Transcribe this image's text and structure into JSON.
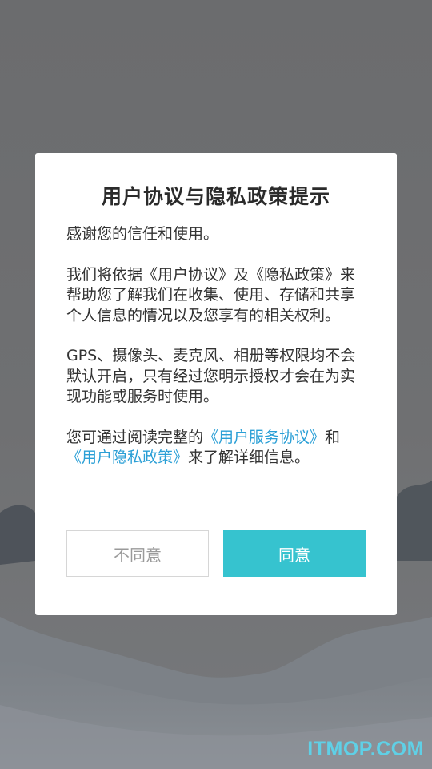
{
  "dialog": {
    "title": "用户协议与隐私政策提示",
    "para1": "感谢您的信任和使用。",
    "para2": "我们将依据《用户协议》及《隐私政策》来帮助您了解我们在收集、使用、存储和共享个人信息的情况以及您享有的相关权利。",
    "para3": "GPS、摄像头、麦克风、相册等权限均不会默认开启，只有经过您明示授权才会在为实现功能或服务时使用。",
    "para4_prefix": "您可通过阅读完整的",
    "link_service": "《用户服务协议》",
    "para4_and": "和",
    "link_privacy": "《用户隐私政策》",
    "para4_suffix": "来了解详细信息。",
    "disagree_label": "不同意",
    "agree_label": "同意"
  },
  "watermark": "ITMOP.COM",
  "colors": {
    "accent": "#36c3cf",
    "link": "#2a9fd6",
    "overlay": "#6e6f71"
  }
}
